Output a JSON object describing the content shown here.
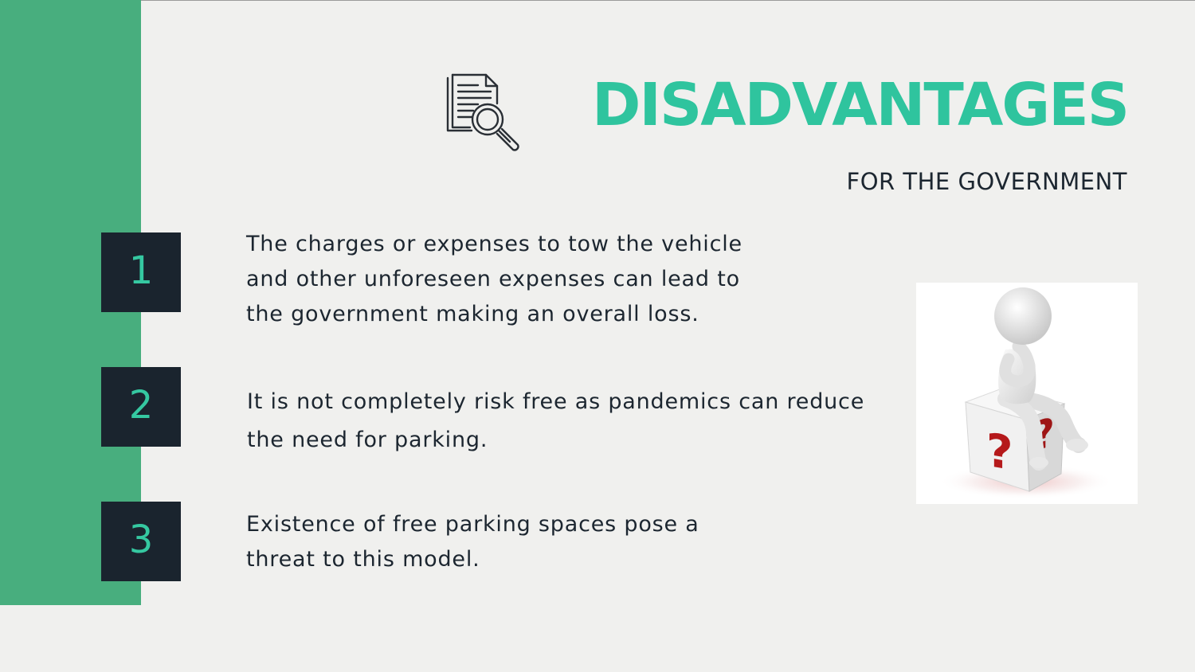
{
  "slide": {
    "title": "DISADVANTAGES",
    "subtitle": "FOR THE GOVERNMENT",
    "title_icon": "document-search-icon",
    "image_icon": "thinking-figure-question-box",
    "colors": {
      "background": "#f0f0ee",
      "sidebar_green": "#48ae7e",
      "title_teal": "#2fc49e",
      "box_dark": "#1a242e",
      "number_teal": "#35c8a1",
      "body_text": "#1c2630",
      "question_red": "#b5191b"
    }
  },
  "points": [
    {
      "number": "1",
      "lines": [
        "The charges or expenses to tow the vehicle",
        "and other unforeseen expenses can lead to",
        "the government making an overall loss."
      ]
    },
    {
      "number": "2",
      "lines": [
        "It is not completely risk free as pandemics can reduce",
        "the need for parking."
      ]
    },
    {
      "number": "3",
      "lines": [
        "Existence of free parking spaces pose a",
        "threat to this model."
      ]
    }
  ]
}
